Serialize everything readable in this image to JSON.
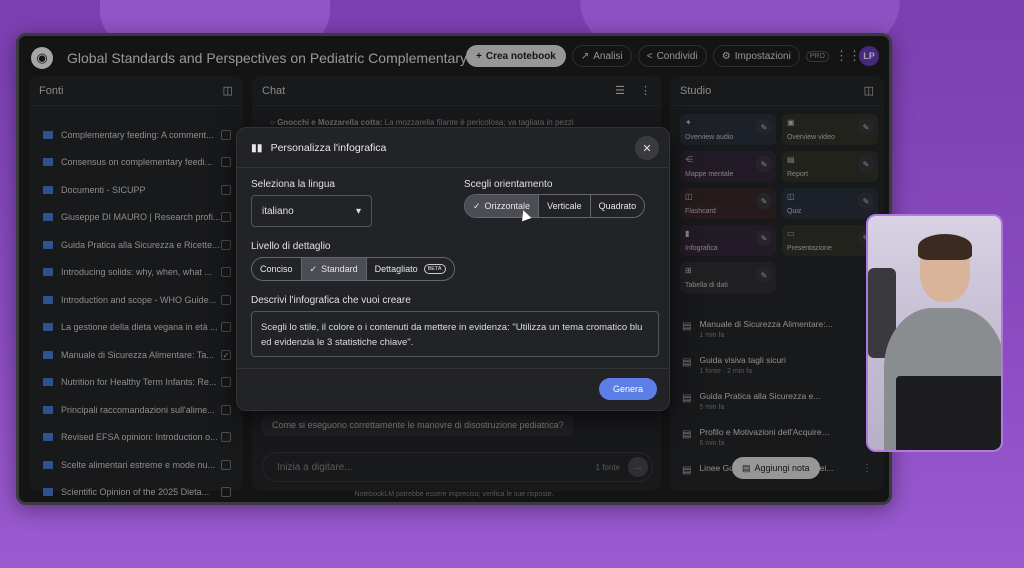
{
  "app": {
    "title": "Global Standards and Perspectives on Pediatric Complementary Feeding",
    "logo_icon": "notebooklm-logo-icon",
    "create_label": "Crea notebook",
    "analytics_label": "Analisi",
    "share_label": "Condividi",
    "settings_label": "Impostazioni",
    "pro_badge": "PRO",
    "avatar_initials": "LP"
  },
  "sources": {
    "header": "Fonti",
    "items": [
      {
        "label": "Complementary feeding: A comment...",
        "checked": ""
      },
      {
        "label": "Consensus on complementary feedi...",
        "checked": ""
      },
      {
        "label": "Documenti - SICUPP",
        "checked": ""
      },
      {
        "label": "Giuseppe DI MAURO | Research profi...",
        "checked": ""
      },
      {
        "label": "Guida Pratica alla Sicurezza e Ricette...",
        "checked": ""
      },
      {
        "label": "Introducing solids: why, when, what ...",
        "checked": ""
      },
      {
        "label": "Introduction and scope - WHO Guide...",
        "checked": ""
      },
      {
        "label": "La gestione della dieta vegana in età ...",
        "checked": ""
      },
      {
        "label": "Manuale di Sicurezza Alimentare: Ta...",
        "checked": "✓"
      },
      {
        "label": "Nutrition for Healthy Term Infants: Re...",
        "checked": ""
      },
      {
        "label": "Principali raccomandazioni sull'alime...",
        "checked": ""
      },
      {
        "label": "Revised EFSA opinion: Introduction o...",
        "checked": ""
      },
      {
        "label": "Scelte alimentari estreme e mode nu...",
        "checked": ""
      },
      {
        "label": "Scientific Opinion of the 2025 Dieta...",
        "checked": ""
      }
    ]
  },
  "chat": {
    "header": "Chat",
    "top_text_bold": "Gnocchi e Mozzarella cotta:",
    "top_text": "La mozzarella filante è pericolosa; va tagliata in pezzi",
    "question": "Come si eseguono correttamente le manovre di disostruzione pediatrica?",
    "input_placeholder": "Inizia a digitare...",
    "source_count": "1 fonte",
    "footer": "NotebookLM potrebbe essere impreciso; verifica le sue risposte."
  },
  "studio": {
    "header": "Studio",
    "tiles": [
      {
        "label": "Overview audio",
        "icon": "audio-icon",
        "color": "t-blue"
      },
      {
        "label": "Overview video",
        "icon": "video-icon",
        "color": "t-olive"
      },
      {
        "label": "Mappe mentale",
        "icon": "mindmap-icon",
        "color": "t-purple"
      },
      {
        "label": "Report",
        "icon": "report-icon",
        "color": "t-olive"
      },
      {
        "label": "Flashcard",
        "icon": "flashcard-icon",
        "color": "t-red"
      },
      {
        "label": "Quiz",
        "icon": "quiz-icon",
        "color": "t-blue"
      },
      {
        "label": "Infografica",
        "icon": "infographic-icon",
        "color": "t-purple"
      },
      {
        "label": "Presentazione",
        "icon": "presentation-icon",
        "color": "t-olive"
      },
      {
        "label": "Tabella di dati",
        "icon": "table-icon",
        "color": "t-gray"
      }
    ],
    "notes": [
      {
        "title": "Manuale di Sicurezza Alimentare:...",
        "sub": "1 min fa"
      },
      {
        "title": "Guida visiva tagli sicuri",
        "sub": "1 fonte · 2 min fa"
      },
      {
        "title": "Guida Pratica alla Sicurezza e...",
        "sub": "5 min fa"
      },
      {
        "title": "Profilo e Motivazioni dell'Acquirent...",
        "sub": "6 min fa"
      },
      {
        "title": "Linee Guida per l'Introduzione dei...",
        "sub": ""
      }
    ],
    "add_note": "Aggiungi nota"
  },
  "modal": {
    "title": "Personalizza l'infografica",
    "language_label": "Seleziona la lingua",
    "language_value": "italiano",
    "orientation_label": "Scegli orientamento",
    "orientation_options": [
      "Orizzontale",
      "Verticale",
      "Quadrato"
    ],
    "orientation_selected": "Orizzontale",
    "detail_label": "Livello di dettaglio",
    "detail_options": [
      "Conciso",
      "Standard",
      "Dettagliato"
    ],
    "detail_selected": "Standard",
    "beta_badge": "BETA",
    "describe_label": "Descrivi l'infografica che vuoi creare",
    "describe_value": "Scegli lo stile, il colore o i contenuti da mettere in evidenza: \"Utilizza un tema cromatico blu ed evidenzia le 3 statistiche chiave\".",
    "generate_label": "Genera"
  },
  "colors": {
    "accent": "#5b7fe6",
    "background": "#8a4cc0",
    "panel": "#26272a"
  }
}
